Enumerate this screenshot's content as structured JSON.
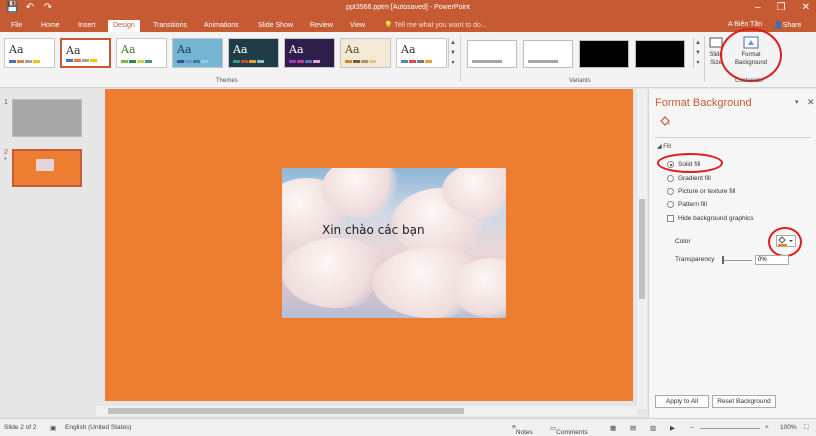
{
  "window": {
    "title": "ppt3566.pptm [Autosaved] - PowerPoint"
  },
  "qat": {
    "save": "💾",
    "undo": "↶",
    "redo": "↷"
  },
  "tabs": {
    "file": "File",
    "home": "Home",
    "insert": "Insert",
    "design": "Design",
    "transitions": "Transitions",
    "animations": "Animations",
    "slideshow": "Slide Show",
    "review": "Review",
    "view": "View",
    "tellme": "Tell me what you want to do...",
    "user": "A Biên Tân",
    "share": "Share"
  },
  "ribbon": {
    "themes_label": "Themes",
    "variants_label": "Variants",
    "customize_label": "Customize",
    "theme_items": [
      {
        "label": "Aa",
        "bg": "#ffffff",
        "fg": "#333333",
        "bars": [
          "#4472c4",
          "#ed7d31",
          "#a5a5a5",
          "#ffc000"
        ]
      },
      {
        "label": "Aa",
        "bg": "#ffffff",
        "fg": "#333333",
        "bars": [
          "#4472c4",
          "#ed7d31",
          "#a5a5a5",
          "#ffc000"
        ]
      },
      {
        "label": "Aa",
        "bg": "#ffffff",
        "fg": "#3e7b2a",
        "bars": [
          "#7ab648",
          "#2a8a4a",
          "#c0d95a",
          "#4a9a6a"
        ]
      },
      {
        "label": "Aa",
        "bg": "#74b5d4",
        "fg": "#1b3a5a",
        "bars": [
          "#2a5a8a",
          "#6a9ac4",
          "#3a7aaa",
          "#9acae4"
        ]
      },
      {
        "label": "Aa",
        "bg": "#1f3c48",
        "fg": "#ffffff",
        "bars": [
          "#3a9a8a",
          "#c44a3a",
          "#e4a43a",
          "#8ac4b4"
        ]
      },
      {
        "label": "Aa",
        "bg": "#2e1f4a",
        "fg": "#ffffff",
        "bars": [
          "#9a3ac4",
          "#c43a8a",
          "#4a7ac4",
          "#e4a4c4"
        ]
      },
      {
        "label": "Aa",
        "bg": "#f3ead5",
        "fg": "#5a4a2a",
        "bars": [
          "#c48a3a",
          "#7a5a3a",
          "#a49a6a",
          "#e4c48a"
        ]
      },
      {
        "label": "Aa",
        "bg": "#ffffff",
        "fg": "#333333",
        "bars": [
          "#4a8ab4",
          "#e44a3a",
          "#7a7a7a",
          "#e4a43a"
        ]
      }
    ],
    "variants": [
      {
        "bg": "#ffffff"
      },
      {
        "bg": "#ffffff"
      },
      {
        "bg": "#000000"
      },
      {
        "bg": "#000000"
      }
    ],
    "slide_size": "Slide Size",
    "format_background": "Format Background"
  },
  "slides": {
    "items": [
      {
        "num": "1",
        "bg": "#a8a8a8"
      },
      {
        "num": "2",
        "bg": "#ed7d31",
        "star": "*"
      }
    ],
    "slide_text": "Xin chào các bạn",
    "slide_bg": "#ed7d31"
  },
  "pane": {
    "title": "Format Background",
    "section": "Fill",
    "options": {
      "solid": "Solid fill",
      "gradient": "Gradient fill",
      "picture": "Picture or texture fill",
      "pattern": "Pattern fill",
      "hide": "Hide background graphics"
    },
    "color_label": "Color",
    "transparency_label": "Transparency",
    "transparency_value": "0%",
    "apply_all": "Apply to All",
    "reset": "Reset Background"
  },
  "status": {
    "slide": "Slide 2 of 2",
    "language": "English (United States)",
    "notes": "Notes",
    "comments": "Comments",
    "zoom": "100%"
  }
}
